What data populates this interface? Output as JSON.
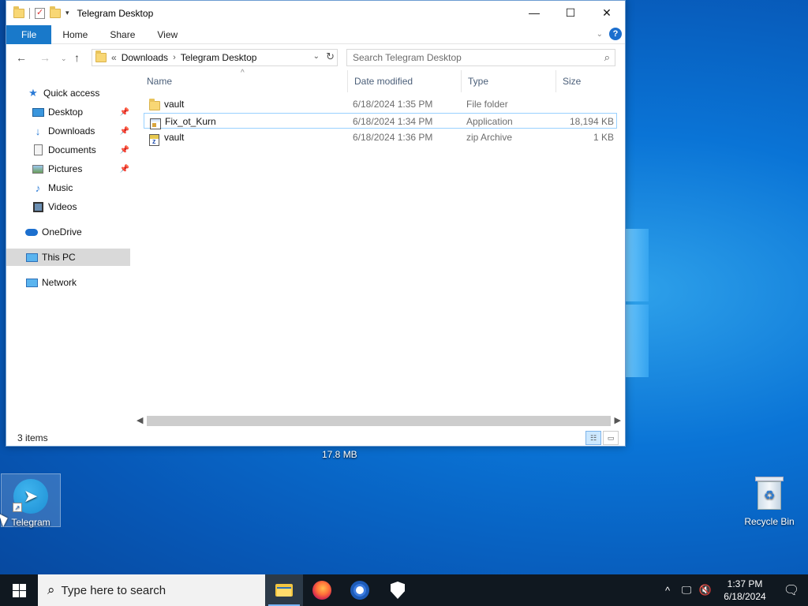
{
  "window": {
    "title": "Telegram Desktop",
    "controls": {
      "minimize": "—",
      "maximize": "☐",
      "close": "✕"
    }
  },
  "ribbon": {
    "tabs": [
      "File",
      "Home",
      "Share",
      "View"
    ]
  },
  "address": {
    "overflow": "«",
    "crumbs": [
      "Downloads",
      "Telegram Desktop"
    ],
    "search_placeholder": "Search Telegram Desktop"
  },
  "nav_pane": {
    "items": [
      {
        "label": "Quick access",
        "icon": "star-icon"
      },
      {
        "label": "Desktop",
        "icon": "desktop-icon",
        "pinned": true
      },
      {
        "label": "Downloads",
        "icon": "download-arrow-icon",
        "pinned": true
      },
      {
        "label": "Documents",
        "icon": "document-icon",
        "pinned": true
      },
      {
        "label": "Pictures",
        "icon": "picture-icon",
        "pinned": true
      },
      {
        "label": "Music",
        "icon": "music-note-icon"
      },
      {
        "label": "Videos",
        "icon": "video-icon"
      },
      {
        "label": "OneDrive",
        "icon": "cloud-icon"
      },
      {
        "label": "This PC",
        "icon": "computer-icon",
        "selected": true
      },
      {
        "label": "Network",
        "icon": "network-icon"
      }
    ]
  },
  "file_list": {
    "columns": [
      "Name",
      "Date modified",
      "Type",
      "Size"
    ],
    "rows": [
      {
        "name": "vault",
        "date": "6/18/2024 1:35 PM",
        "type": "File folder",
        "size": "",
        "icon": "folder-icon"
      },
      {
        "name": "Fix_ot_Kurn",
        "date": "6/18/2024 1:34 PM",
        "type": "Application",
        "size": "18,194 KB",
        "icon": "application-icon"
      },
      {
        "name": "vault",
        "date": "6/18/2024 1:36 PM",
        "type": "zip Archive",
        "size": "1 KB",
        "icon": "zip-archive-icon"
      }
    ]
  },
  "status": {
    "item_count": "3 items"
  },
  "desktop": {
    "behind_window_label": "17.8 MB",
    "icons": [
      {
        "label": "Telegram",
        "icon": "telegram-icon"
      },
      {
        "label": "Recycle Bin",
        "icon": "recycle-bin-icon"
      }
    ]
  },
  "taskbar": {
    "search_placeholder": "Type here to search",
    "apps": [
      "file-explorer-icon",
      "firefox-icon",
      "chrome-icon",
      "security-shield-icon"
    ],
    "clock_time": "1:37 PM",
    "clock_date": "6/18/2024"
  }
}
